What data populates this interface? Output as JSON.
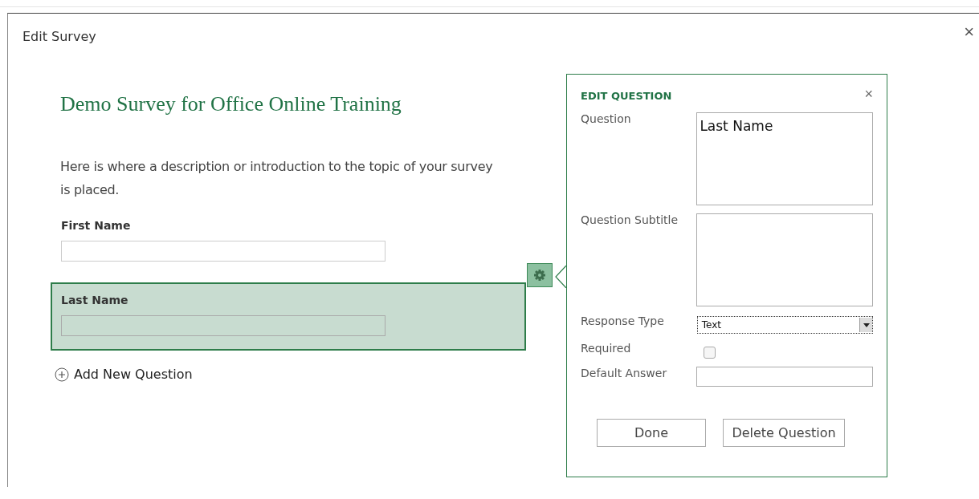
{
  "dialog": {
    "title": "Edit Survey",
    "close": "×"
  },
  "survey": {
    "title": "Demo Survey for Office Online Training",
    "description": "Here is where a description or introduction to the topic of your survey is placed.",
    "questions": [
      {
        "label": "First Name",
        "selected": false
      },
      {
        "label": "Last Name",
        "selected": true
      }
    ],
    "add_button": "Add New Question"
  },
  "edit_panel": {
    "title": "EDIT QUESTION",
    "close": "×",
    "fields": [
      {
        "kind": "textarea",
        "label": "Question",
        "value": "Last Name"
      },
      {
        "kind": "textarea",
        "label": "Question Subtitle"
      },
      {
        "kind": "select",
        "label": "Response Type",
        "value": "Text"
      },
      {
        "kind": "checkbox",
        "label": "Required",
        "checked": false
      },
      {
        "kind": "text",
        "label": "Default Answer"
      }
    ],
    "buttons": [
      "Done",
      "Delete Question"
    ]
  }
}
